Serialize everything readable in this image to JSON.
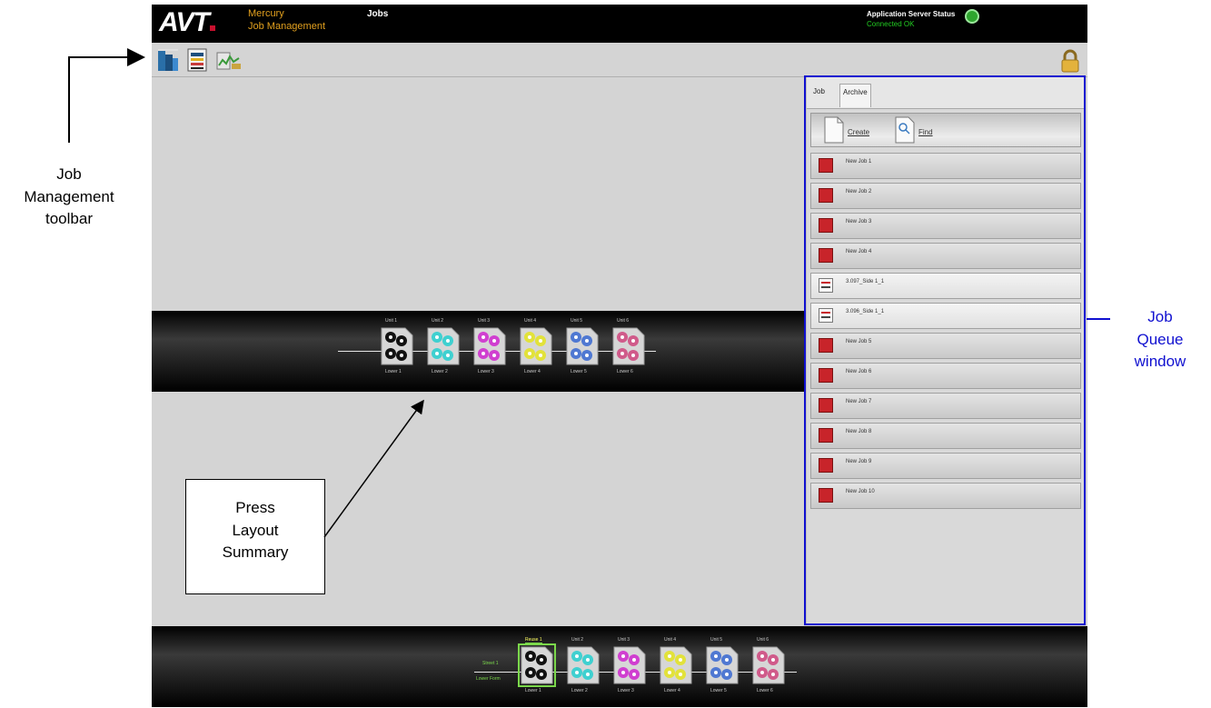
{
  "app": {
    "logo": "AVT",
    "product_line1": "Mercury",
    "product_line2": "Job Management",
    "window_label": "Jobs",
    "server_status_title": "Application Server Status",
    "server_status_value": "Connected OK",
    "status_color": "#2ea52e"
  },
  "toolbar": {
    "buttons": [
      {
        "icon": "layout-summary-icon"
      },
      {
        "icon": "job-setup-icon"
      },
      {
        "icon": "press-operations-icon"
      }
    ],
    "lock_icon": "lock-icon"
  },
  "press_summary_top": {
    "units": [
      {
        "top_label": "Unit 1",
        "bottom_label": "Lower 1",
        "color": "#111111"
      },
      {
        "top_label": "Unit 2",
        "bottom_label": "Lower 2",
        "color": "#3fd0d0"
      },
      {
        "top_label": "Unit 3",
        "bottom_label": "Lower 3",
        "color": "#d03fd0"
      },
      {
        "top_label": "Unit 4",
        "bottom_label": "Lower 4",
        "color": "#e2e23a"
      },
      {
        "top_label": "Unit 5",
        "bottom_label": "Lower 5",
        "color": "#4f78d2"
      },
      {
        "top_label": "Unit 6",
        "bottom_label": "Lower 6",
        "color": "#d05a8a"
      }
    ]
  },
  "press_summary_bottom": {
    "side_labels": [
      "Street 1",
      "Lower Form"
    ],
    "units": [
      {
        "top_label": "Reuse 1",
        "bottom_label": "Lower 1",
        "color": "#111111",
        "selected": true
      },
      {
        "top_label": "Unit 2",
        "bottom_label": "Lower 2",
        "color": "#3fd0d0"
      },
      {
        "top_label": "Unit 3",
        "bottom_label": "Lower 3",
        "color": "#d03fd0"
      },
      {
        "top_label": "Unit 4",
        "bottom_label": "Lower 4",
        "color": "#e2e23a"
      },
      {
        "top_label": "Unit 5",
        "bottom_label": "Lower 5",
        "color": "#4f78d2"
      },
      {
        "top_label": "Unit 6",
        "bottom_label": "Lower 6",
        "color": "#d05a8a"
      }
    ]
  },
  "queue": {
    "tabs": [
      "Job",
      "Archive"
    ],
    "actions": [
      {
        "label": "Create",
        "icon": "create-document-icon"
      },
      {
        "label": "Find",
        "icon": "find-document-icon"
      }
    ],
    "jobs": [
      {
        "name": "New Job 1",
        "icon": "red-job-icon"
      },
      {
        "name": "New Job 2",
        "icon": "red-job-icon"
      },
      {
        "name": "New Job 3",
        "icon": "red-job-icon"
      },
      {
        "name": "New Job 4",
        "icon": "red-job-icon"
      },
      {
        "name": "3.097_Side 1_1",
        "icon": "job-document-icon"
      },
      {
        "name": "3.096_Side 1_1",
        "icon": "job-document-icon"
      },
      {
        "name": "New Job 5",
        "icon": "red-job-icon"
      },
      {
        "name": "New Job 6",
        "icon": "red-job-icon"
      },
      {
        "name": "New Job 7",
        "icon": "red-job-icon"
      },
      {
        "name": "New Job 8",
        "icon": "red-job-icon"
      },
      {
        "name": "New Job 9",
        "icon": "red-job-icon"
      },
      {
        "name": "New Job 10",
        "icon": "red-job-icon"
      }
    ]
  },
  "annotations": {
    "toolbar_label": [
      "Job",
      "Management",
      "toolbar"
    ],
    "press_label": [
      "Press",
      "Layout",
      "Summary"
    ],
    "queue_label": [
      "Job",
      "Queue",
      "window"
    ],
    "queue_color": "#1010d0"
  }
}
